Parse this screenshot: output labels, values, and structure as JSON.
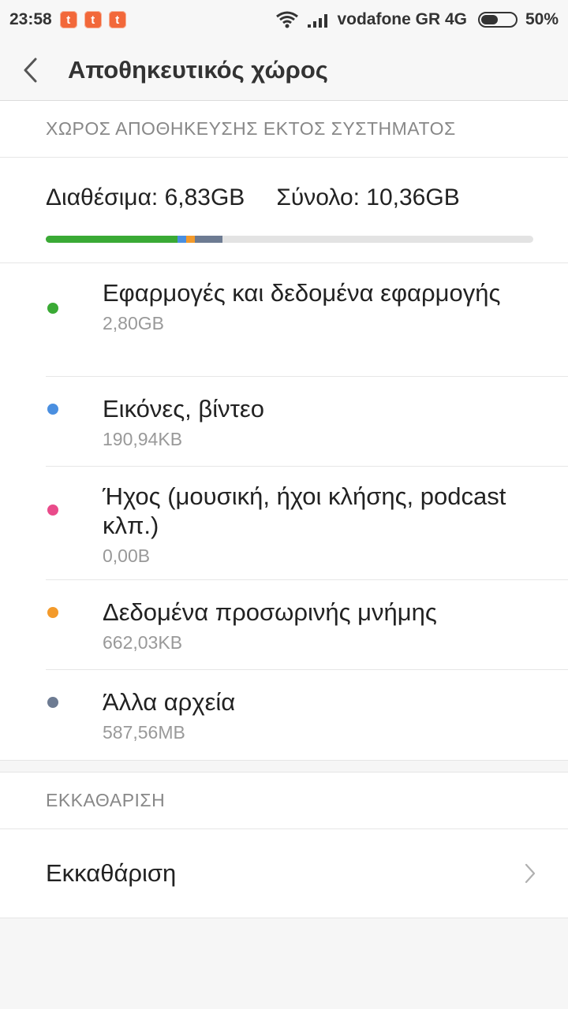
{
  "status_bar": {
    "time": "23:58",
    "notification_letter": "t",
    "carrier": "vodafone GR 4G",
    "battery": "50%",
    "battery_level": 0.5
  },
  "header": {
    "title": "Αποθηκευτικός χώρος"
  },
  "storage": {
    "section_title": "ΧΩΡΟΣ ΑΠΟΘΗΚΕΥΣΗΣ ΕΚΤΟΣ ΣΥΣΤΗΜΑΤΟΣ",
    "available": "Διαθέσιμα: 6,83GB",
    "total": "Σύνολο: 10,36GB",
    "usage_bar": [
      {
        "name": "apps",
        "fraction": 0.27,
        "color": "#3aaa35"
      },
      {
        "name": "images",
        "fraction": 0.018,
        "color": "#4a8fe0"
      },
      {
        "name": "audio",
        "fraction": 0.0,
        "color": "#e94b8a"
      },
      {
        "name": "cache",
        "fraction": 0.018,
        "color": "#f39a2b"
      },
      {
        "name": "other",
        "fraction": 0.056,
        "color": "#6d7b92"
      }
    ],
    "items": [
      {
        "label": "Εφαρμογές και δεδομένα εφαρμογής",
        "size": "2,80GB",
        "color": "#3aaa35"
      },
      {
        "label": "Εικόνες, βίντεο",
        "size": "190,94KB",
        "color": "#4a8fe0"
      },
      {
        "label": "Ήχος (μουσική, ήχοι κλήσης, podcast κλπ.)",
        "size": "0,00B",
        "color": "#e94b8a"
      },
      {
        "label": "Δεδομένα προσωρινής μνήμης",
        "size": "662,03KB",
        "color": "#f39a2b"
      },
      {
        "label": "Άλλα αρχεία",
        "size": "587,56MB",
        "color": "#6d7b92"
      }
    ]
  },
  "cleanup": {
    "section_title": "ΕΚΚΑΘΑΡΙΣΗ",
    "item_label": "Εκκαθάριση"
  }
}
